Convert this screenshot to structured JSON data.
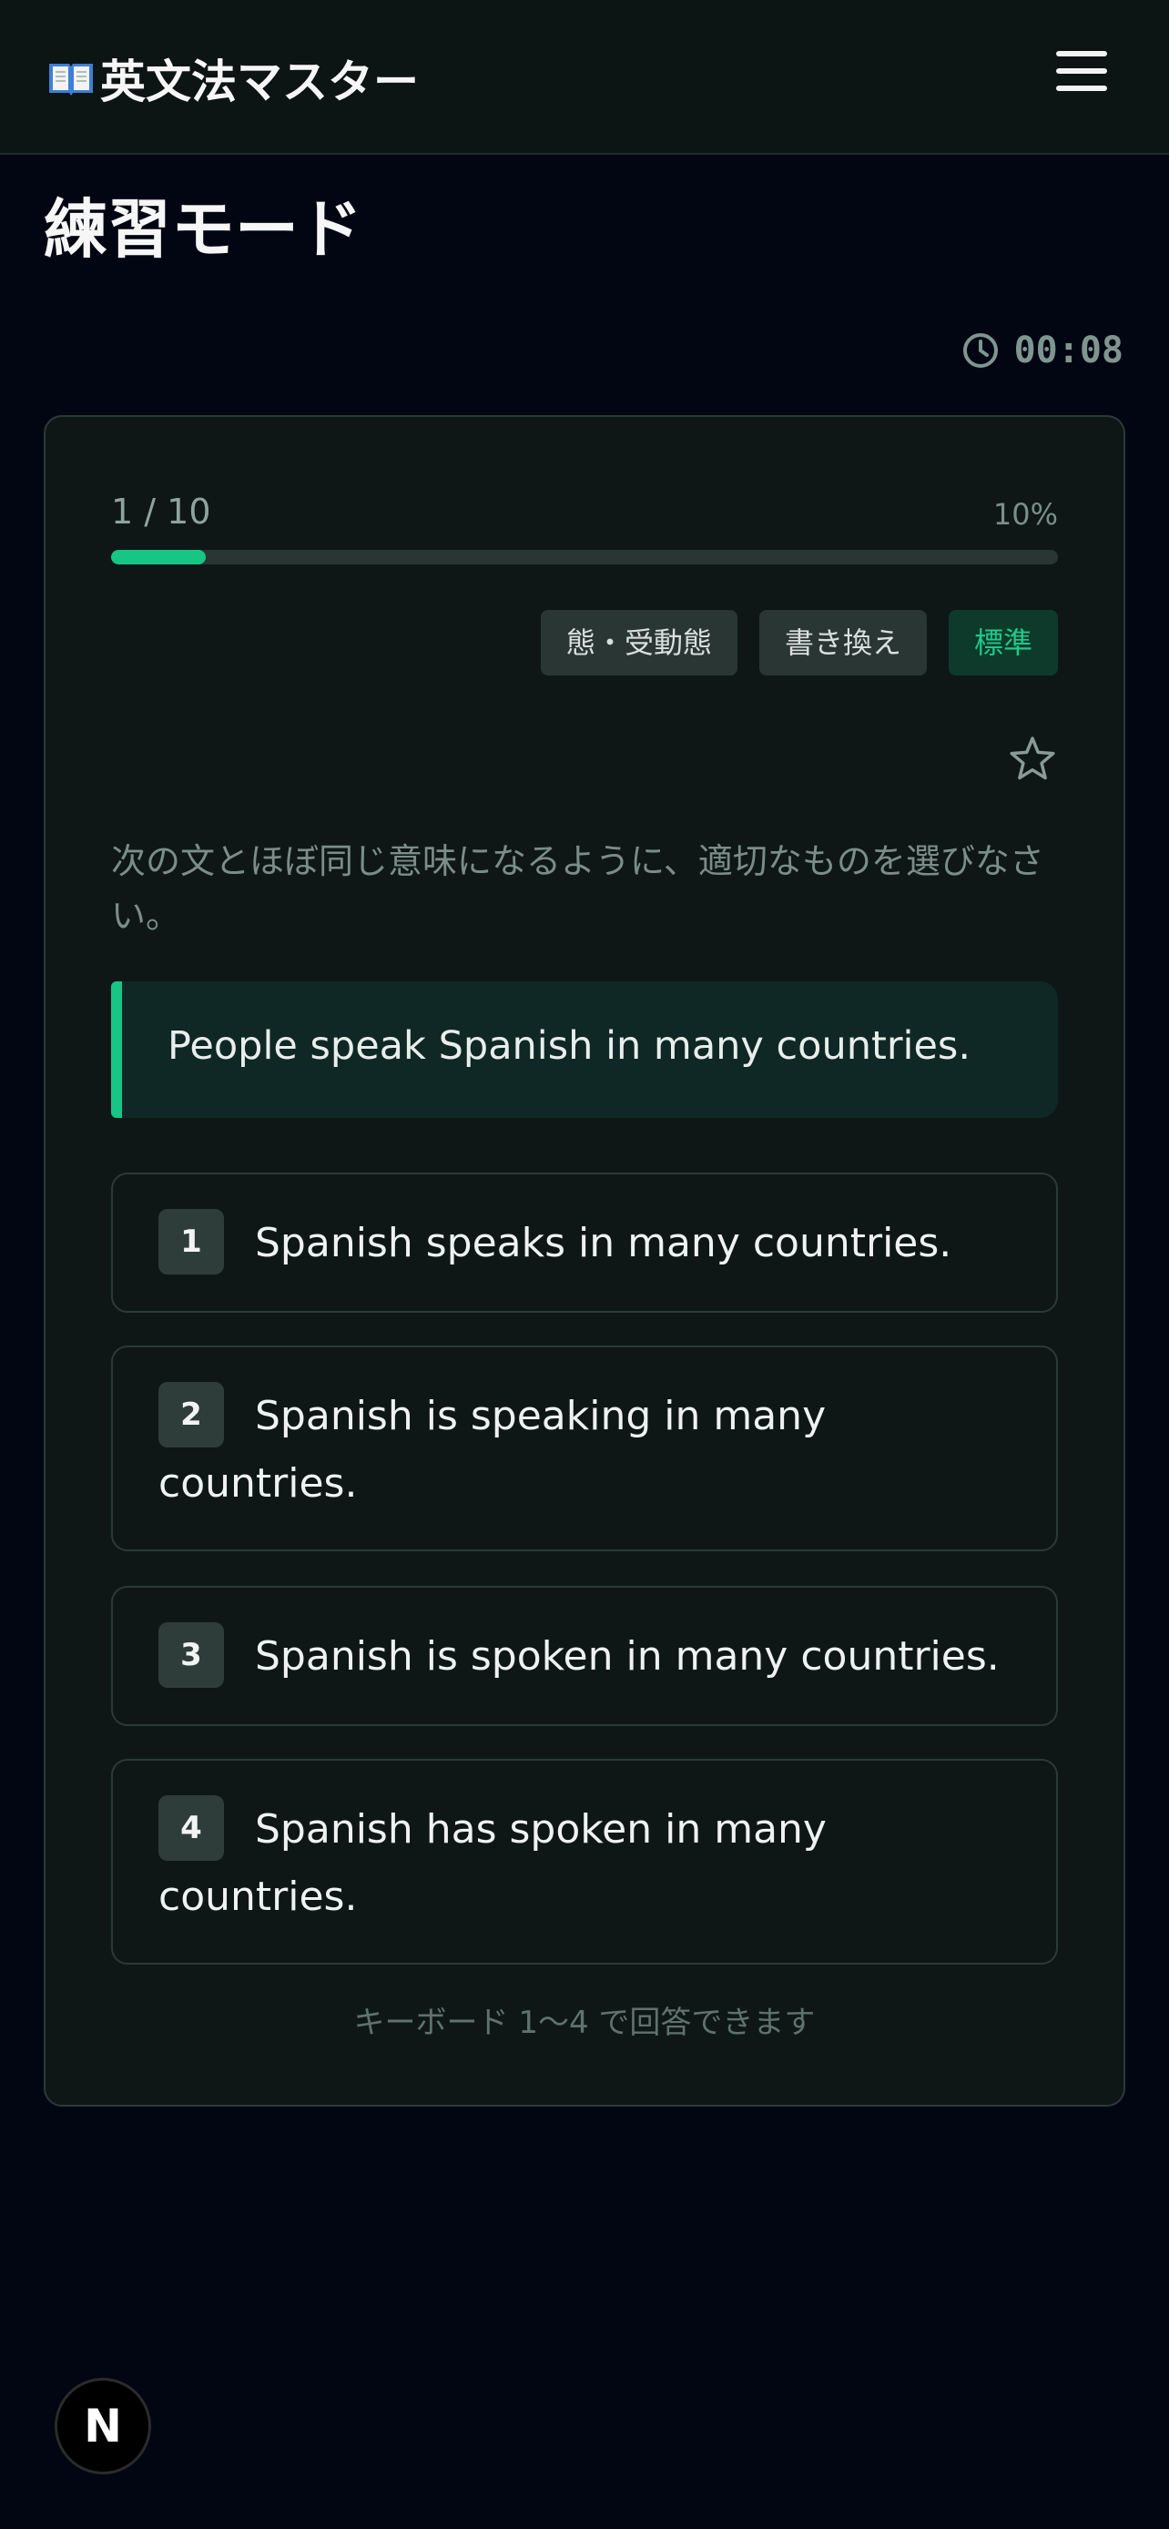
{
  "header": {
    "brand_title": "英文法マスター",
    "brand_icon": "book-icon",
    "menu_icon": "hamburger-icon"
  },
  "page": {
    "title": "練習モード"
  },
  "timer": {
    "value": "00:08",
    "icon": "clock-icon"
  },
  "progress": {
    "label": "1 / 10",
    "percent_label": "10%",
    "fraction": 0.1
  },
  "tags": [
    {
      "label": "態・受動態"
    },
    {
      "label": "書き換え"
    },
    {
      "label": "標準"
    }
  ],
  "question": {
    "instruction": "次の文とほぼ同じ意味になるように、適切なものを選びなさい。",
    "sentence": "People speak Spanish in many countries.",
    "options": [
      {
        "number": "1",
        "text": "Spanish speaks in many countries."
      },
      {
        "number": "2",
        "text": "Spanish is speaking in many countries."
      },
      {
        "number": "3",
        "text": "Spanish is spoken in many countries."
      },
      {
        "number": "4",
        "text": "Spanish has spoken in many countries."
      }
    ],
    "hint": "キーボード 1〜4 で回答できます"
  },
  "badge": {
    "label": "N"
  },
  "colors": {
    "accent": "#17c584",
    "background": "#020612",
    "card": "#0e1716"
  }
}
